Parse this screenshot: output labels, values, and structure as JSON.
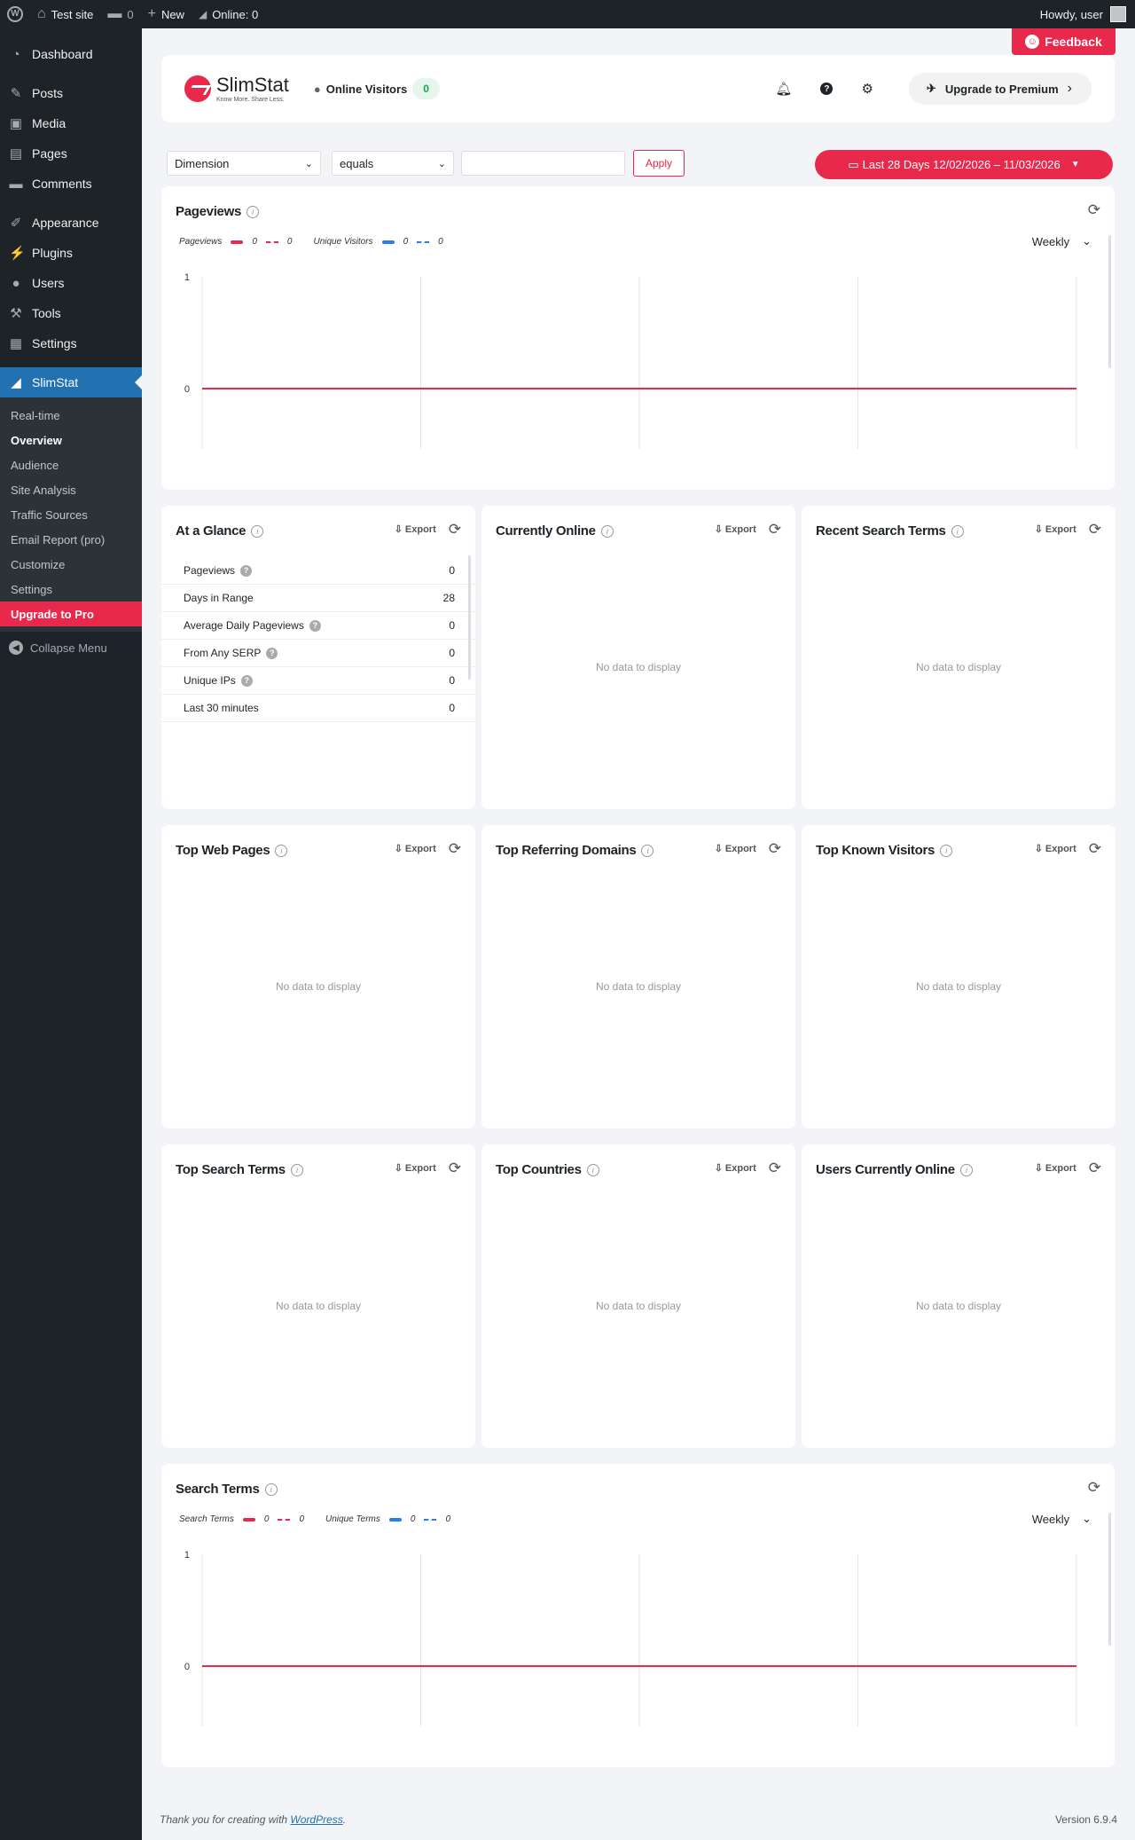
{
  "adminbar": {
    "site_name": "Test site",
    "comments_count": "0",
    "new_label": "New",
    "online_label": "Online: 0",
    "howdy": "Howdy, user"
  },
  "sidebar": {
    "top": [
      {
        "label": "Dashboard",
        "icon": "dashboard-icon"
      }
    ],
    "content": [
      {
        "label": "Posts",
        "icon": "pin-icon"
      },
      {
        "label": "Media",
        "icon": "media-icon"
      },
      {
        "label": "Pages",
        "icon": "pages-icon"
      },
      {
        "label": "Comments",
        "icon": "comment-icon"
      }
    ],
    "admin": [
      {
        "label": "Appearance",
        "icon": "brush-icon"
      },
      {
        "label": "Plugins",
        "icon": "plugin-icon"
      },
      {
        "label": "Users",
        "icon": "users-icon"
      },
      {
        "label": "Tools",
        "icon": "wrench-icon"
      },
      {
        "label": "Settings",
        "icon": "settings-icon"
      }
    ],
    "active": {
      "label": "SlimStat",
      "icon": "chart-icon"
    },
    "submenu": [
      "Real-time",
      "Overview",
      "Audience",
      "Site Analysis",
      "Traffic Sources",
      "Email Report (pro)",
      "Customize",
      "Settings"
    ],
    "upgrade": "Upgrade to Pro",
    "collapse": "Collapse Menu"
  },
  "feedback": "Feedback",
  "header": {
    "logo_name": "SlimStat",
    "logo_tagline": "Know More. Share Less.",
    "online_visitors_label": "Online Visitors",
    "online_visitors_count": "0",
    "upgrade_label": "Upgrade to Premium"
  },
  "filters": {
    "dimension": "Dimension",
    "operator": "equals",
    "value": "",
    "apply": "Apply",
    "date_range": "Last 28 Days 12/02/2026 – 11/03/2026"
  },
  "pageviews_chart": {
    "title": "Pageviews",
    "legend": [
      {
        "name": "Pageviews",
        "current": "0",
        "previous": "0",
        "color": "#e8294c"
      },
      {
        "name": "Unique Visitors",
        "current": "0",
        "previous": "0",
        "color": "#2b7de9"
      }
    ],
    "granularity": "Weekly"
  },
  "search_chart": {
    "title": "Search Terms",
    "legend": [
      {
        "name": "Search Terms",
        "current": "0",
        "previous": "0",
        "color": "#e8294c"
      },
      {
        "name": "Unique Terms",
        "current": "0",
        "previous": "0",
        "color": "#2b7de9"
      }
    ],
    "granularity": "Weekly"
  },
  "chart_data": [
    {
      "type": "line",
      "title": "Pageviews",
      "xlabel": "",
      "ylabel": "",
      "ylim": [
        0,
        1
      ],
      "yticks": [
        "1",
        "0"
      ],
      "series": [
        {
          "name": "Pageviews",
          "values": [
            0,
            0,
            0,
            0,
            0
          ]
        },
        {
          "name": "Unique Visitors",
          "values": [
            0,
            0,
            0,
            0,
            0
          ]
        }
      ],
      "grid": true,
      "legend": "top-left"
    },
    {
      "type": "line",
      "title": "Search Terms",
      "xlabel": "",
      "ylabel": "",
      "ylim": [
        0,
        1
      ],
      "yticks": [
        "1",
        "0"
      ],
      "series": [
        {
          "name": "Search Terms",
          "values": [
            0,
            0,
            0,
            0,
            0
          ]
        },
        {
          "name": "Unique Terms",
          "values": [
            0,
            0,
            0,
            0,
            0
          ]
        }
      ],
      "grid": true,
      "legend": "top-left"
    }
  ],
  "export_label": "Export",
  "no_data": "No data to display",
  "glance": {
    "title": "At a Glance",
    "rows": [
      {
        "label": "Pageviews",
        "value": "0",
        "help": true
      },
      {
        "label": "Days in Range",
        "value": "28",
        "help": false
      },
      {
        "label": "Average Daily Pageviews",
        "value": "0",
        "help": true
      },
      {
        "label": "From Any SERP",
        "value": "0",
        "help": true
      },
      {
        "label": "Unique IPs",
        "value": "0",
        "help": true
      },
      {
        "label": "Last 30 minutes",
        "value": "0",
        "help": false
      }
    ]
  },
  "widgets": {
    "currently_online": "Currently Online",
    "recent_search_terms": "Recent Search Terms",
    "top_web_pages": "Top Web Pages",
    "top_referring_domains": "Top Referring Domains",
    "top_known_visitors": "Top Known Visitors",
    "top_search_terms": "Top Search Terms",
    "top_countries": "Top Countries",
    "users_currently_online": "Users Currently Online"
  },
  "footer": {
    "thanks_prefix": "Thank you for creating with ",
    "wordpress": "WordPress",
    "thanks_suffix": ".",
    "version": "Version 6.9.4"
  }
}
